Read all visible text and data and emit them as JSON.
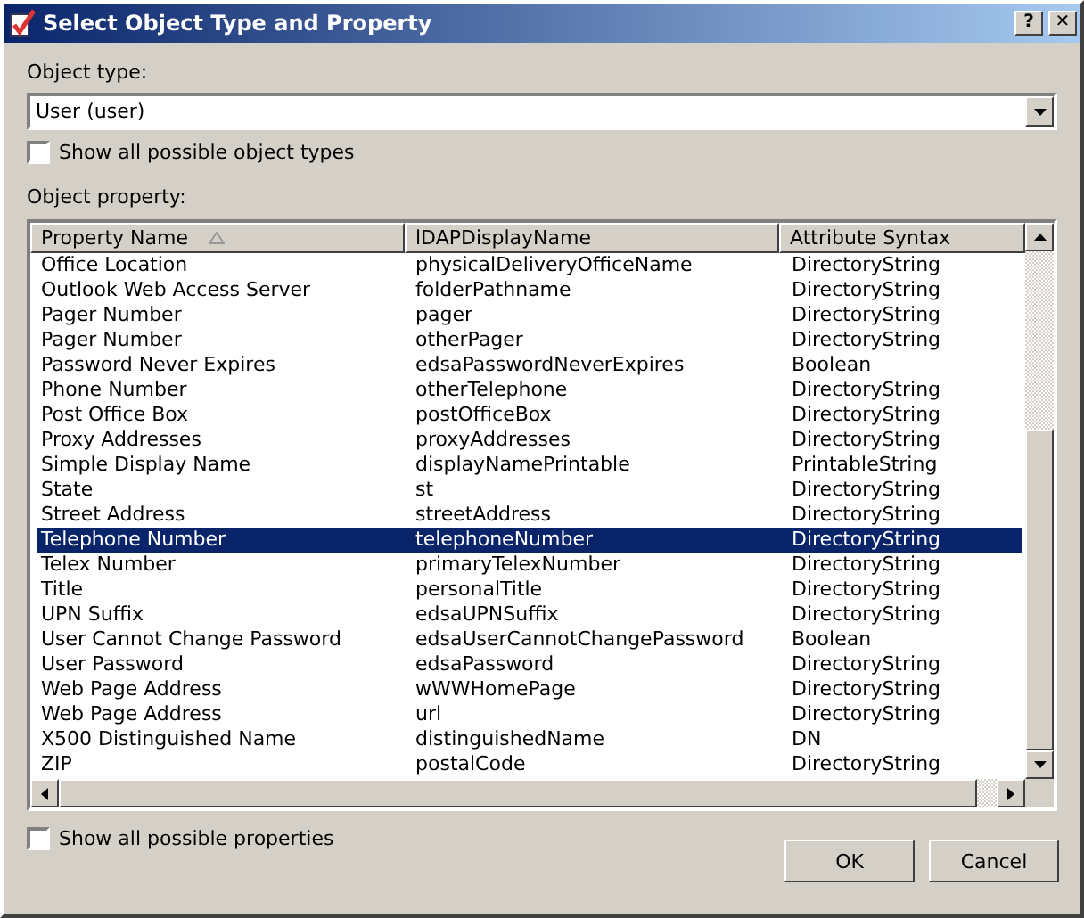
{
  "window": {
    "title": "Select Object Type and Property",
    "help_button": "?",
    "close_button": "✕"
  },
  "object_type": {
    "label": "Object type:",
    "value": "User (user)"
  },
  "show_all_types": {
    "label": "Show all possible object types",
    "checked": false
  },
  "object_property": {
    "label": "Object property:"
  },
  "table": {
    "columns": [
      {
        "label": "Property Name",
        "sorted": true
      },
      {
        "label": "lDAPDisplayName",
        "sorted": false
      },
      {
        "label": "Attribute Syntax",
        "sorted": false
      }
    ],
    "rows": [
      {
        "cells": [
          "Office Location",
          "physicalDeliveryOfficeName",
          "DirectoryString"
        ],
        "selected": false
      },
      {
        "cells": [
          "Outlook Web Access Server",
          "folderPathname",
          "DirectoryString"
        ],
        "selected": false
      },
      {
        "cells": [
          "Pager Number",
          "pager",
          "DirectoryString"
        ],
        "selected": false
      },
      {
        "cells": [
          "Pager Number",
          "otherPager",
          "DirectoryString"
        ],
        "selected": false
      },
      {
        "cells": [
          "Password Never Expires",
          "edsaPasswordNeverExpires",
          "Boolean"
        ],
        "selected": false
      },
      {
        "cells": [
          "Phone Number",
          "otherTelephone",
          "DirectoryString"
        ],
        "selected": false
      },
      {
        "cells": [
          "Post Office Box",
          "postOfficeBox",
          "DirectoryString"
        ],
        "selected": false
      },
      {
        "cells": [
          "Proxy Addresses",
          "proxyAddresses",
          "DirectoryString"
        ],
        "selected": false
      },
      {
        "cells": [
          "Simple Display Name",
          "displayNamePrintable",
          "PrintableString"
        ],
        "selected": false
      },
      {
        "cells": [
          "State",
          "st",
          "DirectoryString"
        ],
        "selected": false
      },
      {
        "cells": [
          "Street Address",
          "streetAddress",
          "DirectoryString"
        ],
        "selected": false
      },
      {
        "cells": [
          "Telephone Number",
          "telephoneNumber",
          "DirectoryString"
        ],
        "selected": true
      },
      {
        "cells": [
          "Telex Number",
          "primaryTelexNumber",
          "DirectoryString"
        ],
        "selected": false
      },
      {
        "cells": [
          "Title",
          "personalTitle",
          "DirectoryString"
        ],
        "selected": false
      },
      {
        "cells": [
          "UPN Suffix",
          "edsaUPNSuffix",
          "DirectoryString"
        ],
        "selected": false
      },
      {
        "cells": [
          "User Cannot Change Password",
          "edsaUserCannotChangePassword",
          "Boolean"
        ],
        "selected": false
      },
      {
        "cells": [
          "User Password",
          "edsaPassword",
          "DirectoryString"
        ],
        "selected": false
      },
      {
        "cells": [
          "Web Page Address",
          "wWWHomePage",
          "DirectoryString"
        ],
        "selected": false
      },
      {
        "cells": [
          "Web Page Address",
          "url",
          "DirectoryString"
        ],
        "selected": false
      },
      {
        "cells": [
          "X500 Distinguished Name",
          "distinguishedName",
          "DN"
        ],
        "selected": false
      },
      {
        "cells": [
          "ZIP",
          "postalCode",
          "DirectoryString"
        ],
        "selected": false
      }
    ]
  },
  "show_all_properties": {
    "label": "Show all possible properties",
    "checked": false
  },
  "buttons": [
    "OK",
    "Cancel"
  ]
}
